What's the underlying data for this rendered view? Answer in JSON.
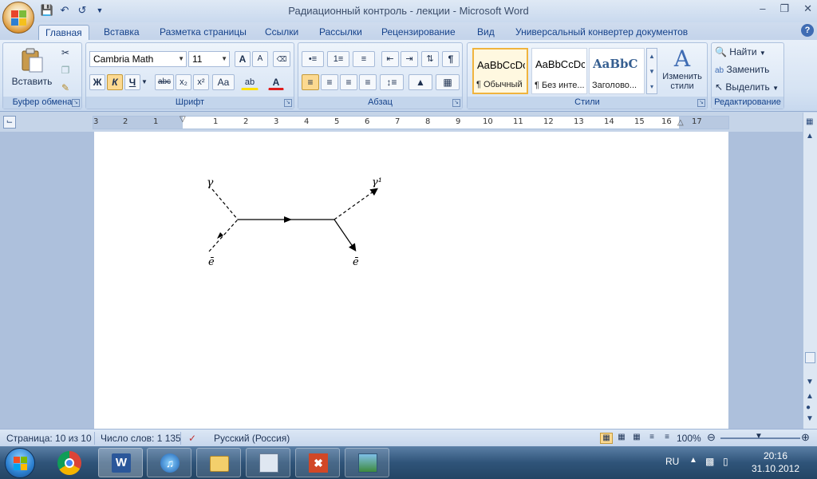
{
  "window": {
    "title": "Радиационный контроль - лекции - Microsoft Word",
    "controls": [
      "–",
      "❐",
      "✕"
    ]
  },
  "tabs": [
    "Главная",
    "Вставка",
    "Разметка страницы",
    "Ссылки",
    "Рассылки",
    "Рецензирование",
    "Вид",
    "Универсальный конвертер документов"
  ],
  "ribbon": {
    "clipboard": {
      "label": "Буфер обмена",
      "paste": "Вставить"
    },
    "font": {
      "label": "Шрифт",
      "font_name": "Cambria Math",
      "font_size": "11",
      "bold": "Ж",
      "italic": "К",
      "underline": "Ч",
      "strike": "abc",
      "sub": "x₂",
      "sup": "x²",
      "case": "Aa",
      "grow": "A",
      "shrink": "A",
      "highlight": "ab",
      "fontcolor": "A"
    },
    "paragraph": {
      "label": "Абзац",
      "pilcrow": "¶"
    },
    "styles": {
      "label": "Стили",
      "cards": [
        {
          "sample": "AaBbCcDc",
          "name": "¶ Обычный"
        },
        {
          "sample": "AaBbCcDc",
          "name": "¶ Без инте..."
        },
        {
          "sample": "AaBbC",
          "name": "Заголово..."
        }
      ],
      "change": "Изменить стили"
    },
    "editing": {
      "label": "Редактирование",
      "find": "Найти",
      "replace": "Заменить",
      "select": "Выделить"
    }
  },
  "ruler": {
    "numbers": [
      "3",
      "2",
      "1",
      "1",
      "1",
      "2",
      "3",
      "4",
      "5",
      "6",
      "7",
      "8",
      "9",
      "10",
      "11",
      "12",
      "13",
      "14",
      "15",
      "16",
      "17"
    ]
  },
  "diagram": {
    "labels": {
      "gamma_in": "γ",
      "gamma_out": "γ¹",
      "electron_in": "ē",
      "electron_out": "ē"
    }
  },
  "status": {
    "page": "Страница: 10 из 10",
    "words": "Число слов: 1 135",
    "lang": "Русский (Россия)",
    "zoom": "100%"
  },
  "taskbar": {
    "lang": "RU",
    "time": "20:16",
    "date": "31.10.2012"
  }
}
